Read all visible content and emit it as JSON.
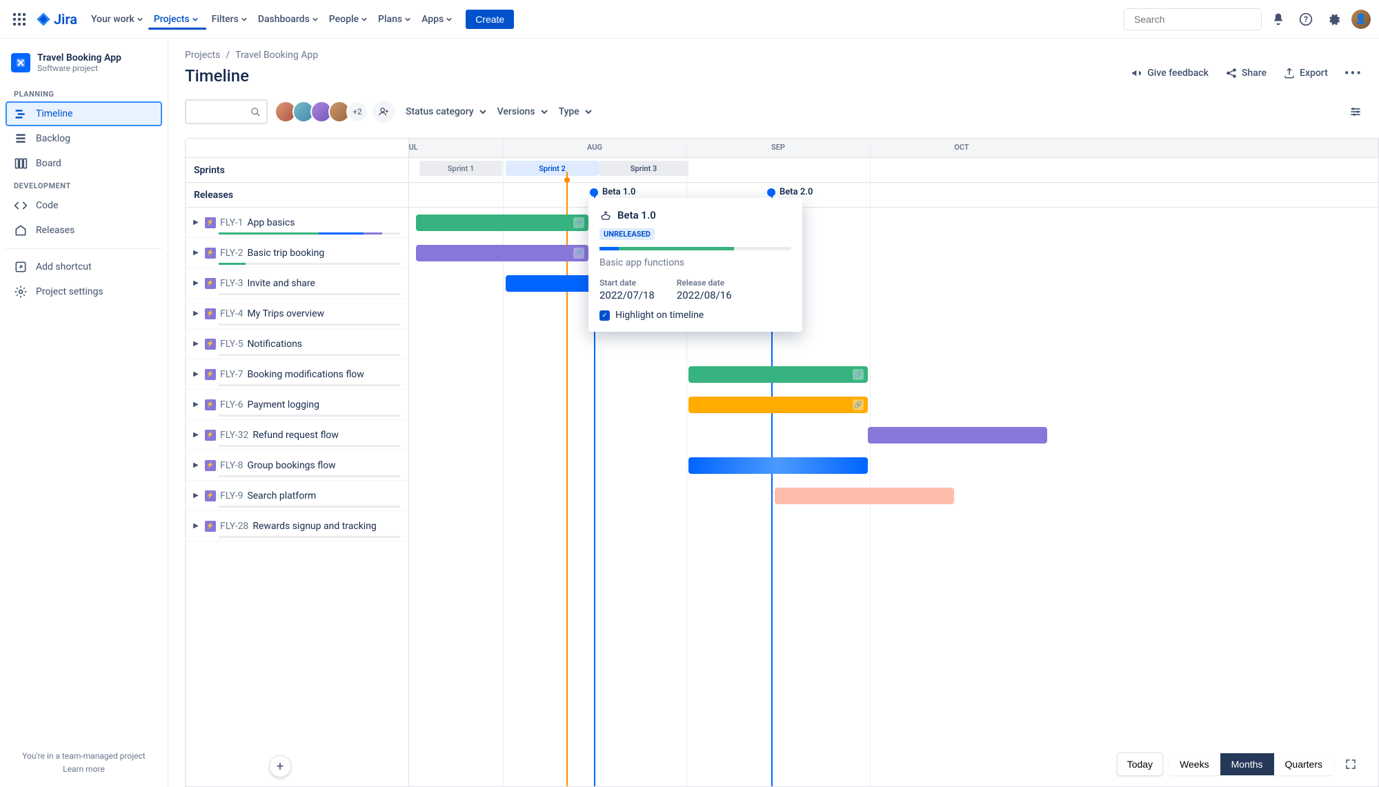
{
  "topnav": {
    "logo_text": "Jira",
    "items": [
      "Your work",
      "Projects",
      "Filters",
      "Dashboards",
      "People",
      "Plans",
      "Apps"
    ],
    "active_index": 1,
    "create": "Create",
    "search_placeholder": "Search"
  },
  "sidebar": {
    "project_name": "Travel Booking App",
    "project_type": "Software project",
    "groups": [
      {
        "label": "PLANNING",
        "items": [
          {
            "icon": "timeline",
            "label": "Timeline",
            "selected": true
          },
          {
            "icon": "backlog",
            "label": "Backlog"
          },
          {
            "icon": "board",
            "label": "Board"
          }
        ]
      },
      {
        "label": "DEVELOPMENT",
        "items": [
          {
            "icon": "code",
            "label": "Code"
          },
          {
            "icon": "releases",
            "label": "Releases"
          }
        ]
      }
    ],
    "bottom": [
      {
        "icon": "shortcut",
        "label": "Add shortcut"
      },
      {
        "icon": "settings",
        "label": "Project settings"
      }
    ],
    "footer_line1": "You're in a team-managed project",
    "footer_link": "Learn more"
  },
  "breadcrumb": [
    "Projects",
    "Travel Booking App"
  ],
  "page_title": "Timeline",
  "header_actions": {
    "feedback": "Give feedback",
    "share": "Share",
    "export": "Export"
  },
  "avatars_more": "+2",
  "filters": {
    "status": "Status category",
    "versions": "Versions",
    "type": "Type"
  },
  "timeline": {
    "months": [
      "JUL",
      "AUG",
      "SEP",
      "OCT"
    ],
    "sprints_header": "Sprints",
    "releases_header": "Releases",
    "sprints": [
      {
        "name": "Sprint 1",
        "state": "done"
      },
      {
        "name": "Sprint 2",
        "state": "active"
      },
      {
        "name": "Sprint 3",
        "state": "future"
      }
    ],
    "releases": [
      {
        "name": "Beta 1.0"
      },
      {
        "name": "Beta 2.0"
      }
    ],
    "rows": [
      {
        "key": "FLY-1",
        "summary": "App basics",
        "progress": [
          [
            "#36B37E",
            55
          ],
          [
            "#0065FF",
            25
          ],
          [
            "#8777D9",
            10
          ]
        ]
      },
      {
        "key": "FLY-2",
        "summary": "Basic trip booking",
        "progress": [
          [
            "#36B37E",
            15
          ],
          [
            "#EBECF0",
            85
          ]
        ]
      },
      {
        "key": "FLY-3",
        "summary": "Invite and share",
        "progress": [
          [
            "#EBECF0",
            100
          ]
        ]
      },
      {
        "key": "FLY-4",
        "summary": "My Trips overview",
        "progress": [
          [
            "#EBECF0",
            100
          ]
        ]
      },
      {
        "key": "FLY-5",
        "summary": "Notifications",
        "progress": [
          [
            "#EBECF0",
            100
          ]
        ]
      },
      {
        "key": "FLY-7",
        "summary": "Booking modifications flow",
        "progress": [
          [
            "#EBECF0",
            100
          ]
        ]
      },
      {
        "key": "FLY-6",
        "summary": "Payment logging",
        "progress": [
          [
            "#EBECF0",
            100
          ]
        ]
      },
      {
        "key": "FLY-32",
        "summary": "Refund request flow",
        "progress": [
          [
            "#EBECF0",
            100
          ]
        ]
      },
      {
        "key": "FLY-8",
        "summary": "Group bookings flow",
        "progress": [
          [
            "#EBECF0",
            100
          ]
        ]
      },
      {
        "key": "FLY-9",
        "summary": "Search platform",
        "progress": [
          [
            "#EBECF0",
            100
          ]
        ]
      },
      {
        "key": "FLY-28",
        "summary": "Rewards signup and tracking",
        "progress": [
          [
            "#EBECF0",
            100
          ]
        ]
      }
    ]
  },
  "popover": {
    "title": "Beta 1.0",
    "status": "UNRELEASED",
    "description": "Basic app functions",
    "start_label": "Start date",
    "start_value": "2022/07/18",
    "release_label": "Release date",
    "release_value": "2022/08/16",
    "highlight": "Highlight on timeline"
  },
  "zoom": {
    "today": "Today",
    "weeks": "Weeks",
    "months": "Months",
    "quarters": "Quarters"
  }
}
